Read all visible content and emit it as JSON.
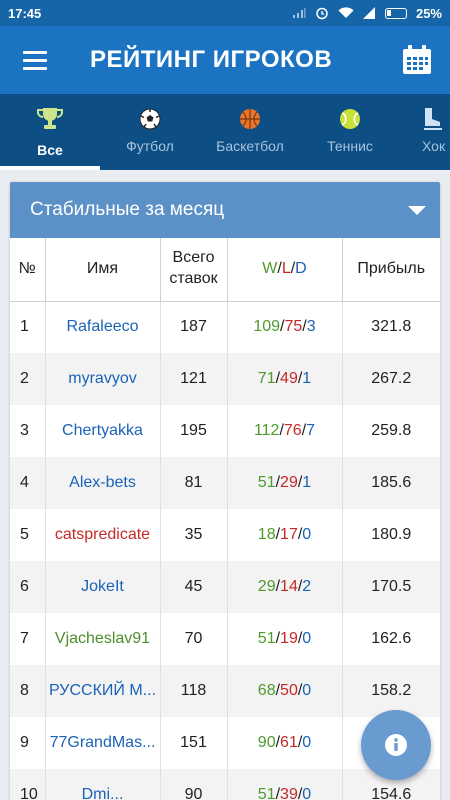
{
  "status_bar": {
    "time": "17:45",
    "battery_percent": "25%"
  },
  "app_bar": {
    "title": "РЕЙТИНГ ИГРОКОВ"
  },
  "tabs": [
    {
      "label": "Все",
      "icon": "trophy-icon",
      "active": true
    },
    {
      "label": "Футбол",
      "icon": "soccer-ball-icon"
    },
    {
      "label": "Баскетбол",
      "icon": "basketball-icon"
    },
    {
      "label": "Теннис",
      "icon": "tennis-ball-icon"
    },
    {
      "label": "Хок",
      "icon": "hockey-skate-icon"
    }
  ],
  "filter": {
    "selected": "Стабильные за месяц"
  },
  "table": {
    "headers": {
      "num": "№",
      "name": "Имя",
      "bets": "Всего ставок",
      "wld_w": "W",
      "wld_l": "L",
      "wld_d": "D",
      "wld_sep": "/",
      "profit": "Прибыль"
    },
    "rows": [
      {
        "num": "1",
        "name": "Rafaleeco",
        "name_color": "blue",
        "bets": "187",
        "w": "109",
        "l": "75",
        "d": "3",
        "profit": "321.8"
      },
      {
        "num": "2",
        "name": "myravyov",
        "name_color": "blue",
        "bets": "121",
        "w": "71",
        "l": "49",
        "d": "1",
        "profit": "267.2"
      },
      {
        "num": "3",
        "name": "Chertyakka",
        "name_color": "blue",
        "bets": "195",
        "w": "112",
        "l": "76",
        "d": "7",
        "profit": "259.8"
      },
      {
        "num": "4",
        "name": "Alex-bets",
        "name_color": "blue",
        "bets": "81",
        "w": "51",
        "l": "29",
        "d": "1",
        "profit": "185.6"
      },
      {
        "num": "5",
        "name": "catspredicate",
        "name_color": "red",
        "bets": "35",
        "w": "18",
        "l": "17",
        "d": "0",
        "profit": "180.9"
      },
      {
        "num": "6",
        "name": "JokeIt",
        "name_color": "blue",
        "bets": "45",
        "w": "29",
        "l": "14",
        "d": "2",
        "profit": "170.5"
      },
      {
        "num": "7",
        "name": "Vjacheslav91",
        "name_color": "green",
        "bets": "70",
        "w": "51",
        "l": "19",
        "d": "0",
        "profit": "162.6"
      },
      {
        "num": "8",
        "name": "РУССКИЙ М...",
        "name_color": "blue",
        "bets": "118",
        "w": "68",
        "l": "50",
        "d": "0",
        "profit": "158.2"
      },
      {
        "num": "9",
        "name": "77GrandMas...",
        "name_color": "blue",
        "bets": "151",
        "w": "90",
        "l": "61",
        "d": "0",
        "profit": ""
      },
      {
        "num": "10",
        "name": "Dmi...",
        "name_color": "blue",
        "bets": "90",
        "w": "51",
        "l": "39",
        "d": "0",
        "profit": "154.6"
      }
    ]
  },
  "fab": {
    "icon": "info-icon"
  },
  "colors": {
    "status_bar": "#1565a8",
    "app_bar": "#1b73c2",
    "tab_bar": "#0d4e85",
    "dropdown": "#5c91c8",
    "win": "#4f9a2c",
    "loss": "#c62828",
    "draw": "#1a63b8",
    "fab": "#6a9bd0"
  }
}
